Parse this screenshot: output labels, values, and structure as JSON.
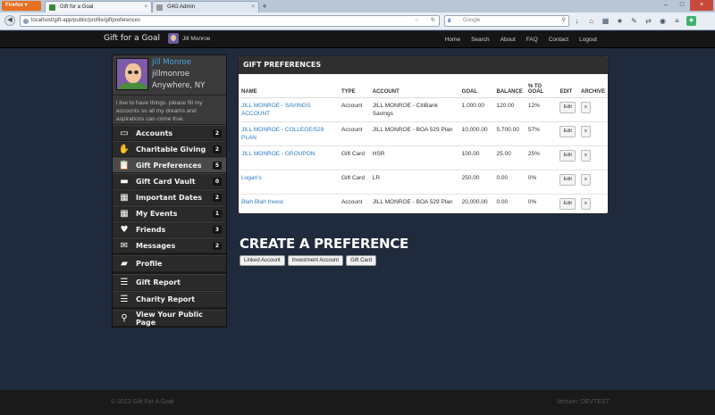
{
  "browser": {
    "menu_label": "Firefox",
    "tabs": [
      {
        "label": "Gift for a Goal",
        "active": true
      },
      {
        "label": "G4G Admin",
        "active": false
      }
    ],
    "url": "localhost/gift-app/public/profile/giftpreferences",
    "search_engine": "Google",
    "search_placeholder": "Google"
  },
  "header": {
    "brand": "Gift for a Goal",
    "user_name": "Jill Monroe",
    "nav": [
      "Home",
      "Search",
      "About",
      "FAQ",
      "Contact",
      "Logout"
    ]
  },
  "profile": {
    "name": "Jill Monroe",
    "handle": "jillmonroe",
    "location": "Anywhere, NY",
    "bio": "i live to have things. please fill my accounts so all my dreams and aspirations can come true."
  },
  "menu": {
    "main": [
      {
        "label": "Accounts",
        "count": "2",
        "icon": "credit-card-icon"
      },
      {
        "label": "Charitable Giving",
        "count": "2",
        "icon": "hands-icon"
      },
      {
        "label": "Gift Preferences",
        "count": "5",
        "icon": "clipboard-icon",
        "active": true
      },
      {
        "label": "Gift Card Vault",
        "count": "0",
        "icon": "card-icon"
      },
      {
        "label": "Important Dates",
        "count": "2",
        "icon": "calendar-icon"
      },
      {
        "label": "My Events",
        "count": "1",
        "icon": "calendar-icon"
      },
      {
        "label": "Friends",
        "count": "3",
        "icon": "friends-icon"
      },
      {
        "label": "Messages",
        "count": "2",
        "icon": "envelope-icon"
      }
    ],
    "profile": "Profile",
    "gift_report": "Gift Report",
    "charity_report": "Charity Report",
    "public_page": "View Your Public Page"
  },
  "panel": {
    "title": "GIFT PREFERENCES",
    "columns": [
      "NAME",
      "TYPE",
      "ACCOUNT",
      "GOAL",
      "BALANCE",
      "% TO GOAL",
      "EDIT",
      "ARCHIVE"
    ],
    "rows": [
      {
        "name": "JILL MONROE - SAVINGS ACCOUNT",
        "type": "Account",
        "account": "JILL MONROE - CitiBank Savings",
        "goal": "1,000.00",
        "balance": "120.00",
        "pct": "12%"
      },
      {
        "name": "JILL MONROE - COLLEGE/529 PLAN",
        "type": "Account",
        "account": "JILL MONROE - BOA 529 Plan",
        "goal": "10,000.00",
        "balance": "5,700.00",
        "pct": "57%"
      },
      {
        "name": "JILL MONROE - GROUPON",
        "type": "Gift Card",
        "account": "HSR",
        "goal": "100.00",
        "balance": "25.00",
        "pct": "25%"
      },
      {
        "name": "Logan's",
        "type": "Gift Card",
        "account": "LR",
        "goal": "250.00",
        "balance": "0.00",
        "pct": "0%"
      },
      {
        "name": "Blah Blah Invest",
        "type": "Account",
        "account": "JILL MONROE - BOA 529 Plan",
        "goal": "20,000.00",
        "balance": "0.00",
        "pct": "0%"
      }
    ],
    "edit_label": "Edit",
    "archive_label": "x"
  },
  "create": {
    "title": "CREATE A PREFERENCE",
    "buttons": [
      "Linked Account",
      "Investment Account",
      "Gift Card"
    ]
  },
  "footer": {
    "copyright": "© 2013 Gift For A Goal",
    "version": "Version: DEVTEST"
  }
}
